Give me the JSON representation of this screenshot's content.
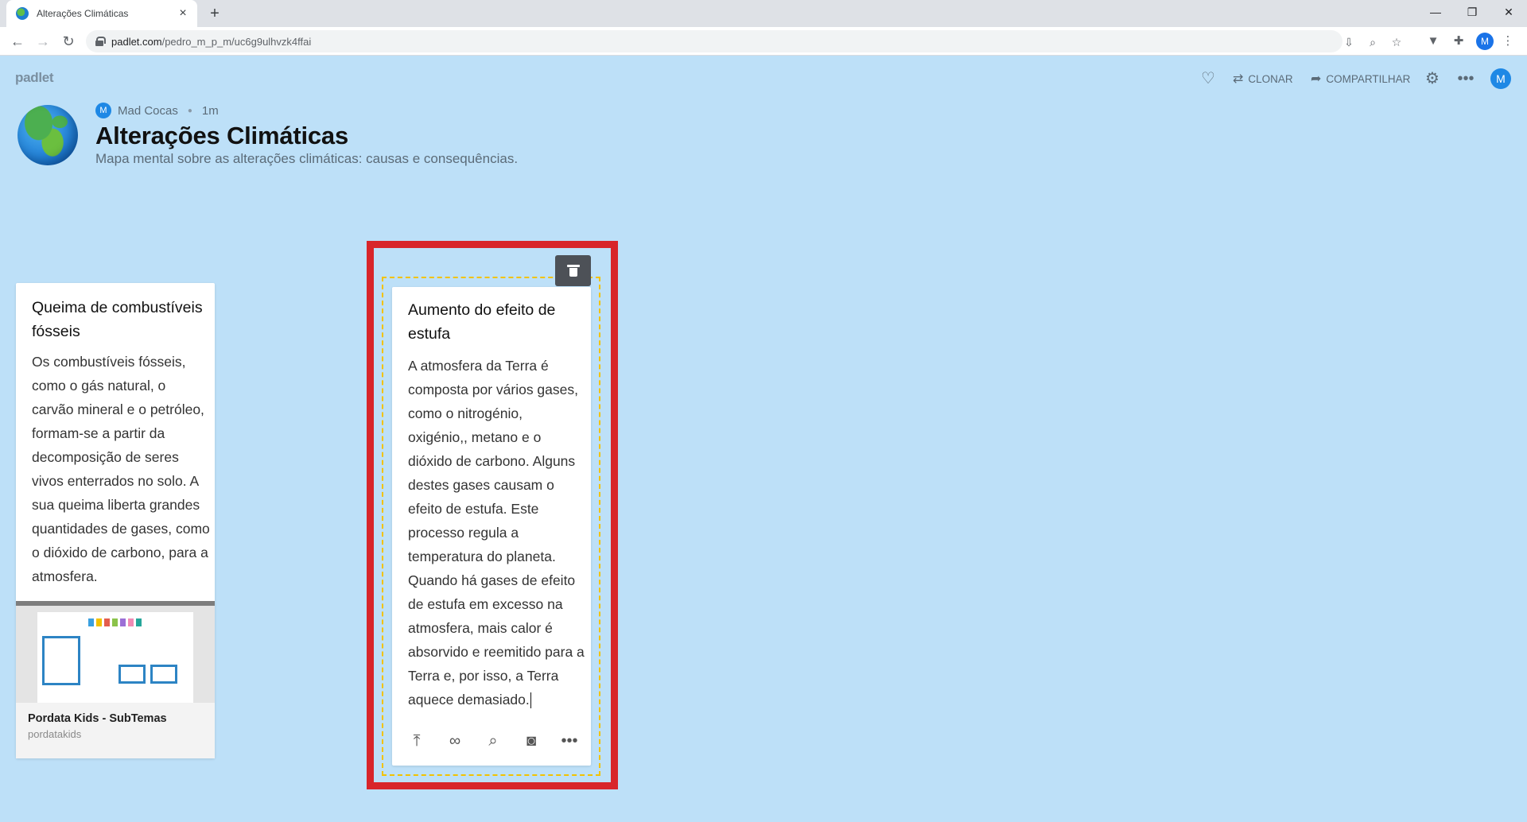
{
  "browser": {
    "tab_title": "Alterações Climáticas",
    "url_host": "padlet.com",
    "url_path": "/pedro_m_p_m/uc6g9ulhvzk4ffai",
    "profile_initial": "M"
  },
  "header": {
    "logo": "padlet",
    "clone_label": "CLONAR",
    "share_label": "COMPARTILHAR",
    "avatar_initial": "M"
  },
  "board": {
    "author_initial": "M",
    "author": "Mad Cocas",
    "time_ago": "1m",
    "title": "Alterações Climáticas",
    "description": "Mapa mental sobre as alterações climáticas: causas e consequências."
  },
  "posts": [
    {
      "subject": "Queima de combustíveis fósseis",
      "body": "Os combustíveis fósseis, como o gás natural, o carvão mineral e o petróleo, formam-se a partir da decomposição de seres vivos enterrados no solo. A sua queima liberta grandes quantidades de gases, como o dióxido de carbono, para a atmosfera.",
      "attachment": {
        "title": "Pordata Kids - SubTemas",
        "source": "pordatakids"
      }
    },
    {
      "subject": "Aumento do efeito de estufa",
      "body": "A atmosfera da Terra é composta por vários gases, como o nitrogénio, oxigénio,, metano e o dióxido de carbono. Alguns destes gases causam o efeito de estufa. Este processo regula a temperatura do planeta. Quando há gases de efeito de estufa em excesso na atmosfera, mais calor é absorvido e reemitido para a Terra e, por isso, a Terra aquece demasiado."
    }
  ],
  "colors": {
    "background": "#bde0f8",
    "selection": "#d8252a",
    "dashed_outline": "#f2c200",
    "accent": "#1e88e5"
  }
}
